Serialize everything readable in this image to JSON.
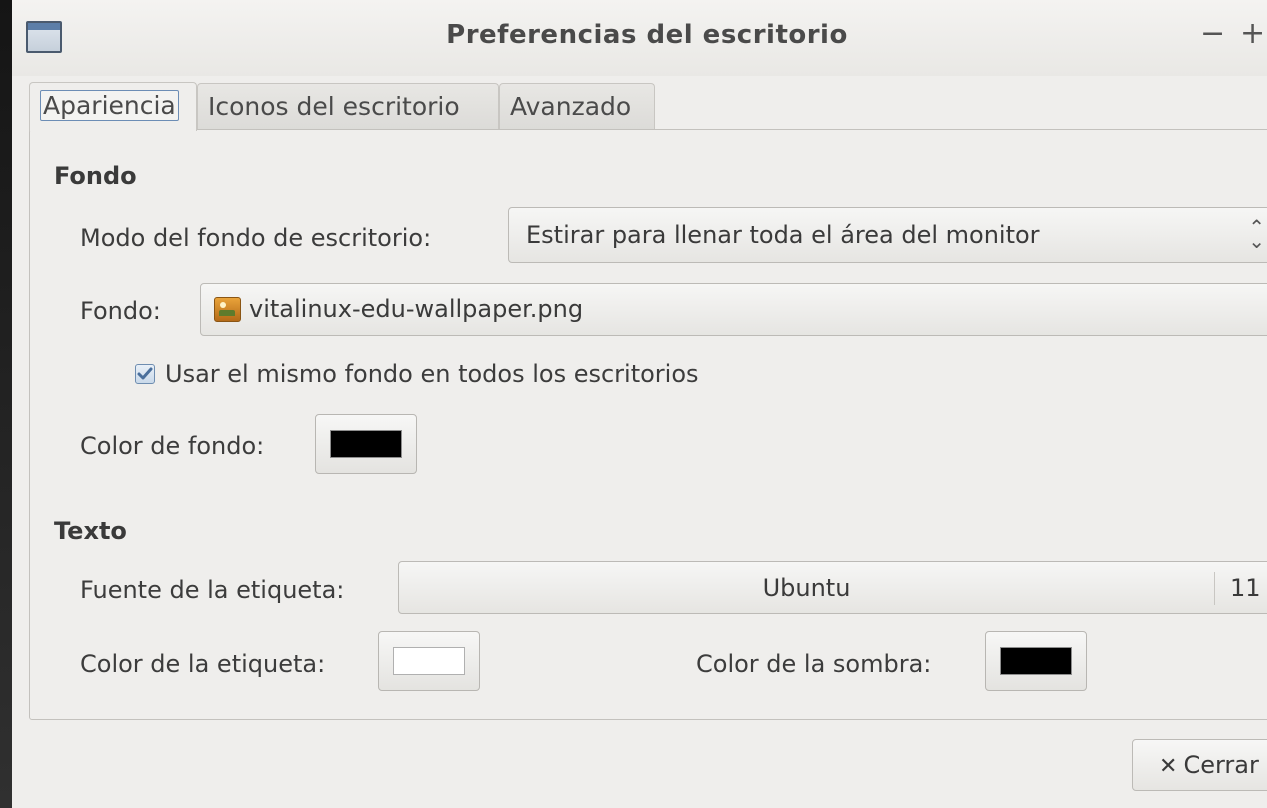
{
  "window": {
    "title": "Preferencias del escritorio",
    "minimize_glyph": "−",
    "maximize_glyph": "+"
  },
  "tabs": [
    {
      "label": "Apariencia",
      "active": true
    },
    {
      "label": "Iconos del escritorio",
      "active": false
    },
    {
      "label": "Avanzado",
      "active": false
    }
  ],
  "fondo_section": {
    "heading": "Fondo",
    "mode_label": "Modo del fondo de escritorio:",
    "mode_value": "Estirar para llenar toda el área del monitor",
    "file_label": "Fondo:",
    "file_value": "vitalinux-edu-wallpaper.png",
    "same_bg_checkbox_label": "Usar el mismo fondo en todos los escritorios",
    "same_bg_checked": true,
    "bg_color_label": "Color de fondo:",
    "bg_color": "#000000"
  },
  "texto_section": {
    "heading": "Texto",
    "font_label": "Fuente de la etiqueta:",
    "font_name": "Ubuntu",
    "font_size": "11",
    "label_color_label": "Color de la etiqueta:",
    "label_color": "#ffffff",
    "shadow_color_label": "Color de la sombra:",
    "shadow_color": "#000000"
  },
  "footer": {
    "close_label": "Cerrar",
    "close_icon": "✕"
  },
  "colors": {
    "selection_accent": "#6c8db5",
    "checkbox_accent": "#4a6f9c"
  }
}
